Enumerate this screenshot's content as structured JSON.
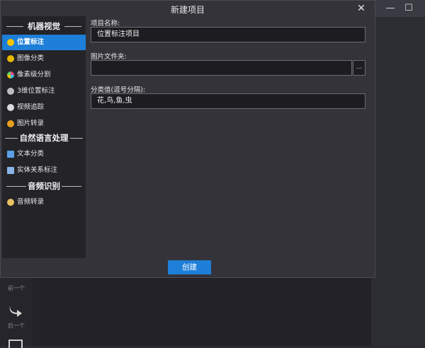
{
  "dialog": {
    "title": "新建项目",
    "close_glyph": "✕",
    "create_label": "创建"
  },
  "sidebar": {
    "sections": [
      {
        "title": "机器视觉",
        "items": [
          {
            "label": "位置标注",
            "icon": "location-tag-icon",
            "color": "#f5c400",
            "active": true
          },
          {
            "label": "图像分类",
            "icon": "image-classify-icon",
            "color": "#e8b800",
            "active": false
          },
          {
            "label": "像素级分割",
            "icon": "pixel-segment-icon",
            "color": "#e84a8a",
            "active": false
          },
          {
            "label": "3维位置标注",
            "icon": "3d-tag-icon",
            "color": "#bdbdbd",
            "active": false
          },
          {
            "label": "视频追踪",
            "icon": "video-track-icon",
            "color": "#dcdcdc",
            "active": false
          },
          {
            "label": "图片转录",
            "icon": "image-transcribe-icon",
            "color": "#e8a020",
            "active": false
          }
        ]
      },
      {
        "title": "自然语言处理",
        "items": [
          {
            "label": "文本分类",
            "icon": "text-classify-icon",
            "color": "#5aa0e8",
            "active": false
          },
          {
            "label": "实体关系标注",
            "icon": "entity-relation-icon",
            "color": "#8ab4e8",
            "active": false
          }
        ]
      },
      {
        "title": "音频识别",
        "items": [
          {
            "label": "音频转录",
            "icon": "audio-transcribe-icon",
            "color": "#e8c060",
            "active": false
          }
        ]
      }
    ]
  },
  "form": {
    "project_name_label": "项目名称:",
    "project_name_value": "位置标注项目",
    "folder_label": "图片文件夹:",
    "folder_value": "",
    "browse_label": "...",
    "classes_label": "分类值(逗号分隔):",
    "classes_value": "花,鸟,鱼,虫"
  },
  "background": {
    "prev_label": "前一个",
    "next_label": "后一个",
    "minimize_glyph": "—",
    "maximize_glyph": "☐"
  }
}
